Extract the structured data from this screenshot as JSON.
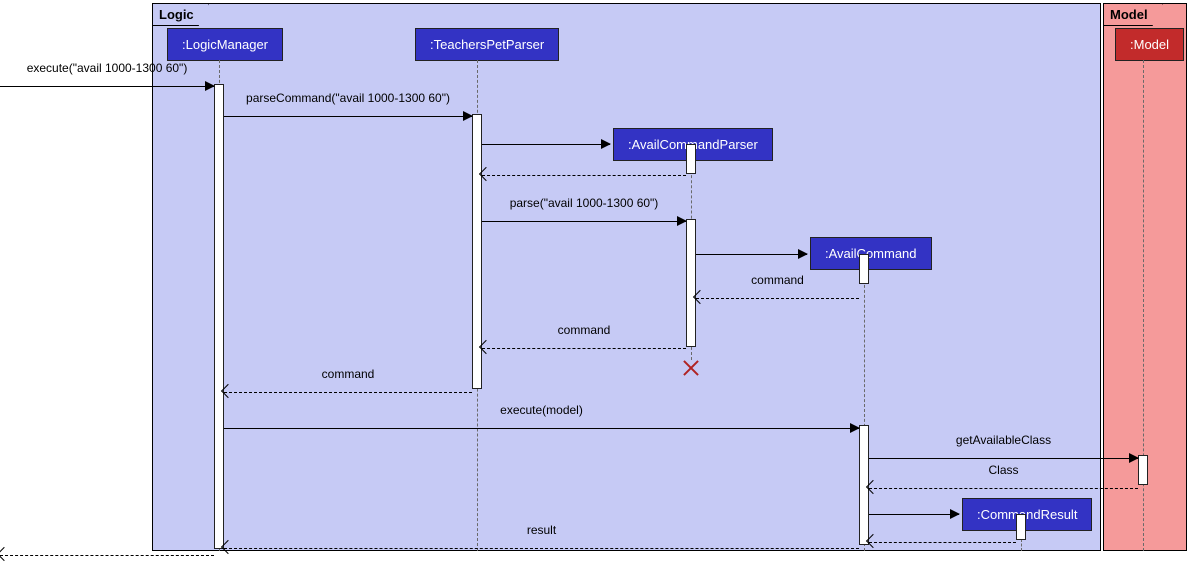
{
  "frames": {
    "logic": {
      "label": "Logic"
    },
    "model": {
      "label": "Model"
    }
  },
  "participants": {
    "logicManager": ":LogicManager",
    "teachersPetParser": ":TeachersPetParser",
    "availCommandParser": ":AvailCommandParser",
    "availCommand": ":AvailCommand",
    "commandResult": ":CommandResult",
    "model": ":Model"
  },
  "messages": {
    "entry": "execute(\"avail 1000-1300 60\")",
    "parseCommand": "parseCommand(\"avail 1000-1300 60\")",
    "createParser": "",
    "returnParser": "",
    "parse": "parse(\"avail 1000-1300 60\")",
    "createAvailCmd": "",
    "returnCommand1": "command",
    "returnCommand2": "command",
    "returnCommand3": "command",
    "executeModel": "execute(model)",
    "getAvailableClass": "getAvailableClass",
    "returnClass": "Class",
    "createCmdResult": "",
    "returnCmdResult": "",
    "returnResult": "result",
    "exit": ""
  }
}
